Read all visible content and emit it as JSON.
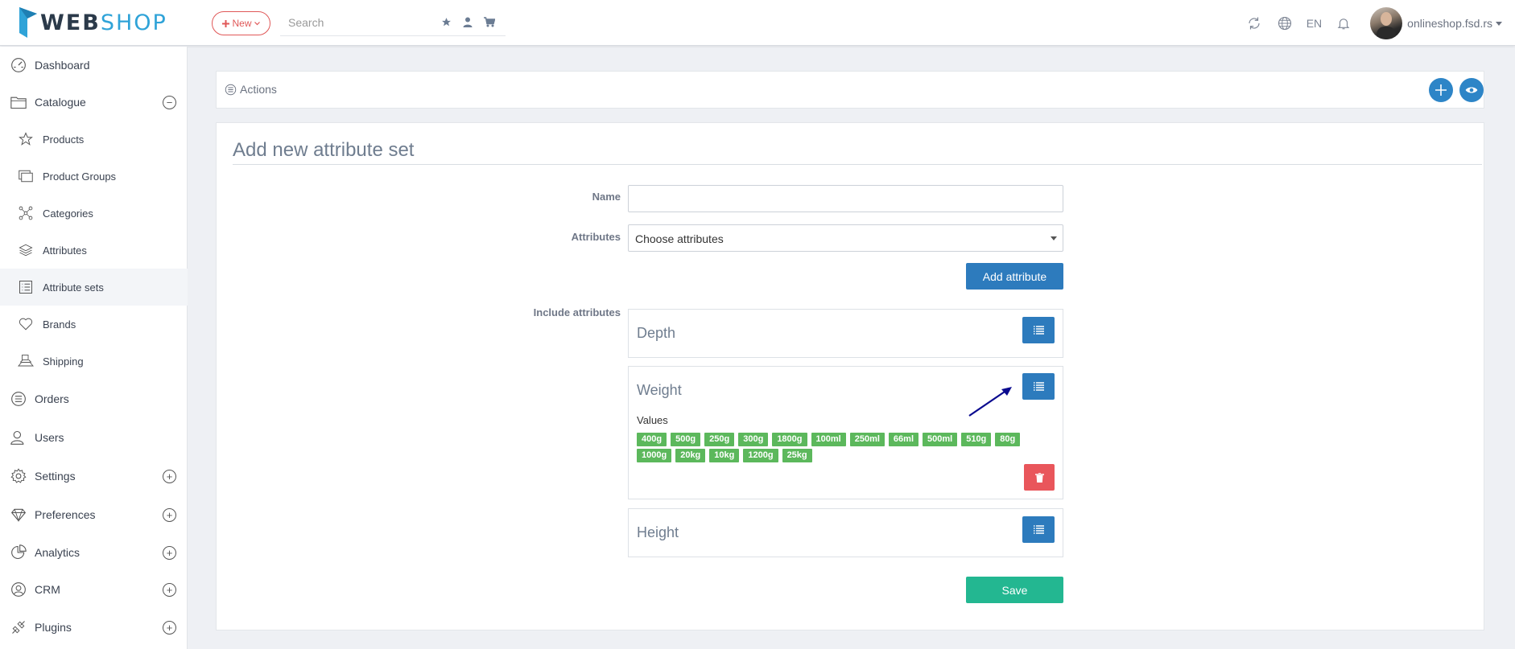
{
  "brand": {
    "part1": "WEB",
    "part2": "SHOP"
  },
  "header": {
    "new_label": "New",
    "search_placeholder": "Search",
    "language": "EN",
    "user": "onlineshop.fsd.rs"
  },
  "sidebar": {
    "items": [
      {
        "label": "Dashboard",
        "icon": "dashboard-icon"
      },
      {
        "label": "Catalogue",
        "icon": "folder-icon",
        "toggle": "minus"
      },
      {
        "label": "Products",
        "icon": "star-icon"
      },
      {
        "label": "Product Groups",
        "icon": "product-groups-icon"
      },
      {
        "label": "Categories",
        "icon": "categories-icon"
      },
      {
        "label": "Attributes",
        "icon": "layers-icon"
      },
      {
        "label": "Attribute sets",
        "icon": "list-icon",
        "active": true
      },
      {
        "label": "Brands",
        "icon": "heart-icon"
      },
      {
        "label": "Shipping",
        "icon": "shipping-icon"
      },
      {
        "label": "Orders",
        "icon": "orders-icon"
      },
      {
        "label": "Users",
        "icon": "user-icon"
      },
      {
        "label": "Settings",
        "icon": "gear-icon",
        "toggle": "plus"
      },
      {
        "label": "Preferences",
        "icon": "diamond-icon",
        "toggle": "plus"
      },
      {
        "label": "Analytics",
        "icon": "pie-chart-icon",
        "toggle": "plus"
      },
      {
        "label": "CRM",
        "icon": "crm-icon",
        "toggle": "plus"
      },
      {
        "label": "Plugins",
        "icon": "plugins-icon",
        "toggle": "plus"
      }
    ]
  },
  "actions": {
    "label": "Actions"
  },
  "page": {
    "title": "Add new attribute set",
    "name_label": "Name",
    "name_value": "",
    "attributes_label": "Attributes",
    "attributes_selected": "Choose attributes",
    "add_attribute_button": "Add attribute",
    "include_label": "Include attributes",
    "values_label": "Values",
    "save_button": "Save"
  },
  "included_attributes": [
    {
      "name": "Depth",
      "values": []
    },
    {
      "name": "Weight",
      "values": [
        "400g",
        "500g",
        "250g",
        "300g",
        "1800g",
        "100ml",
        "250ml",
        "66ml",
        "500ml",
        "510g",
        "80g",
        "1000g",
        "20kg",
        "10kg",
        "1200g",
        "25kg"
      ]
    },
    {
      "name": "Height",
      "values": []
    }
  ],
  "colors": {
    "primary": "#2d7bbd",
    "success": "#23b791",
    "tag": "#5cb85c",
    "danger": "#e9565b",
    "new_button": "#e05858"
  }
}
